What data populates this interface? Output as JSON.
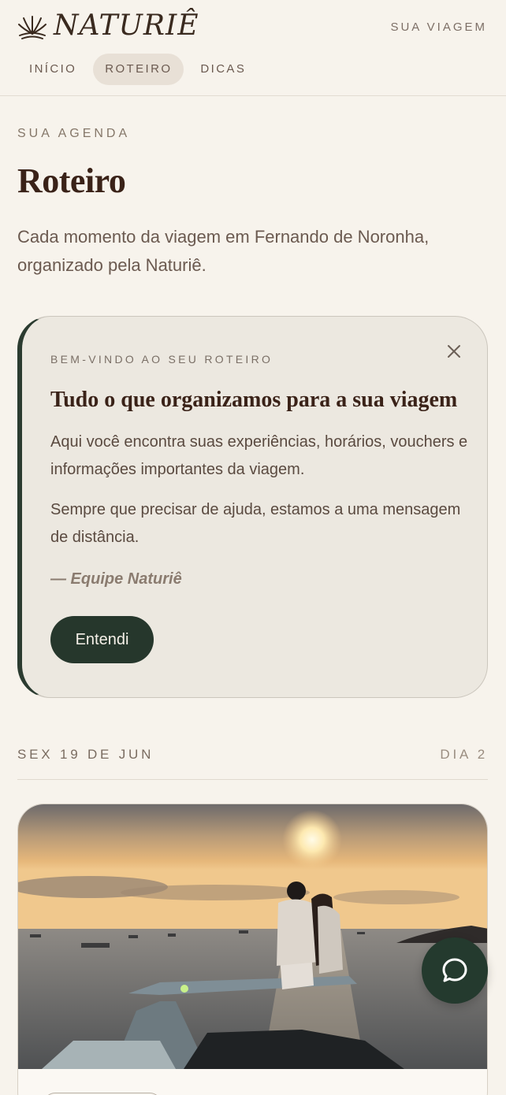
{
  "brand": {
    "name": "NATURIÊ",
    "logo_icon": "sun-leaf-logo-icon"
  },
  "header": {
    "trip_link": "SUA VIAGEM"
  },
  "nav": {
    "tabs": [
      "INÍCIO",
      "ROTEIRO",
      "DICAS"
    ],
    "active": "ROTEIRO"
  },
  "page": {
    "eyebrow": "SUA AGENDA",
    "title": "Roteiro",
    "subtitle": "Cada momento da viagem em Fernando de Noronha, organizado pela Naturiê."
  },
  "welcome": {
    "eyebrow": "BEM-VINDO AO SEU ROTEIRO",
    "title": "Tudo o que organizamos para a sua viagem",
    "paragraph1": "Aqui você encontra suas experiências, horários, vouchers e informações importantes da viagem.",
    "paragraph2": "Sempre que precisar de ajuda, estamos a uma mensagem de distância.",
    "signature": "— Equipe Naturiê",
    "button_label": "Entendi",
    "close_icon": "close-icon"
  },
  "day": {
    "date": "SEX 19 DE JUN",
    "day_label": "DIA 2"
  },
  "chat": {
    "icon": "chat-bubble-icon"
  },
  "colors": {
    "background": "#f7f3ec",
    "accent": "#26372c",
    "card": "#ece8e0",
    "text": "#3a2218"
  }
}
